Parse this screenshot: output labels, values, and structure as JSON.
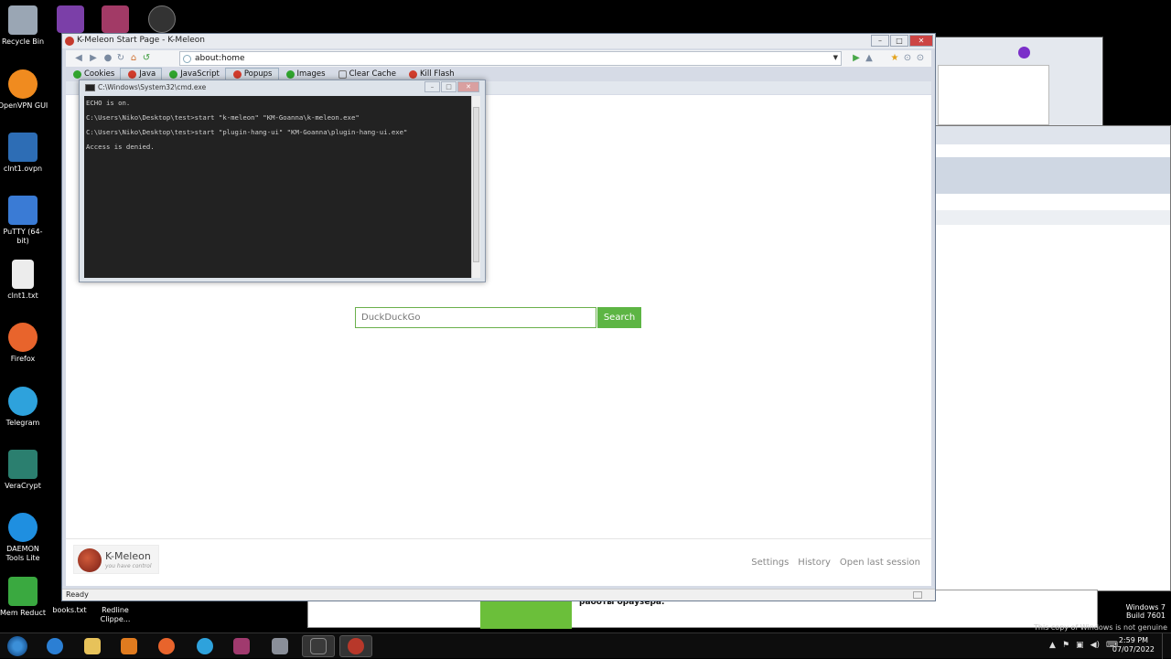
{
  "desktop": {
    "icons": [
      {
        "label": "Recycle Bin",
        "color": "#9aa6b4"
      },
      {
        "label": "OpenVPN GUI",
        "color": "#f08b1f"
      },
      {
        "label": "clnt1.ovpn",
        "color": "#2d6db5"
      },
      {
        "label": "PuTTY (64-bit)",
        "color": "#3a7bd5"
      },
      {
        "label": "clnt1.txt",
        "color": "#ececec"
      },
      {
        "label": "Firefox",
        "color": "#e8642c"
      },
      {
        "label": "Telegram",
        "color": "#2ea2dc"
      },
      {
        "label": "VeraCrypt",
        "color": "#2b7f6f"
      },
      {
        "label": "DAEMON Tools Lite",
        "color": "#1f8fe0"
      },
      {
        "label": "Mem Reduct",
        "color": "#3aa940"
      }
    ],
    "second_column": [
      {
        "label": "books.txt"
      },
      {
        "label": "Redline Clippe..."
      }
    ]
  },
  "browser": {
    "window_title": "K-Meleon Start Page - K-Meleon",
    "address": "about:home",
    "plugins": [
      {
        "label": "Cookies",
        "state": "green",
        "active": false
      },
      {
        "label": "Java",
        "state": "red",
        "active": true
      },
      {
        "label": "JavaScript",
        "state": "green",
        "active": false
      },
      {
        "label": "Popups",
        "state": "red",
        "active": true
      },
      {
        "label": "Images",
        "state": "green",
        "active": false
      },
      {
        "label": "Clear Cache",
        "state": "none",
        "active": false
      },
      {
        "label": "Kill Flash",
        "state": "red",
        "active": false
      }
    ],
    "search": {
      "placeholder": "DuckDuckGo",
      "button": "Search"
    },
    "logo": {
      "name": "K-Meleon",
      "tagline": "you have control"
    },
    "footer_links": [
      "Settings",
      "History",
      "Open last session"
    ],
    "status": "Ready"
  },
  "cmd": {
    "title": "C:\\Windows\\System32\\cmd.exe",
    "lines": [
      "ECHO is on.",
      "C:\\Users\\Niko\\Desktop\\test>start \"k-meleon\" \"KM-Goanna\\k-meleon.exe\"",
      "C:\\Users\\Niko\\Desktop\\test>start \"plugin-hang-ui\" \"KM-Goanna\\plugin-hang-ui.exe\"",
      "Access is denied."
    ]
  },
  "background": {
    "notice_text": "работы браузера.",
    "watermark": {
      "line1": "Windows 7",
      "line2": "Build 7601",
      "genuine": "This copy of Windows is not genuine"
    }
  },
  "taskbar": {
    "apps": [
      {
        "name": "ie",
        "color": "#2b7fd4"
      },
      {
        "name": "explorer",
        "color": "#e7c25a"
      },
      {
        "name": "media",
        "color": "#e07b1f"
      },
      {
        "name": "firefox",
        "color": "#e8642c"
      },
      {
        "name": "telegram",
        "color": "#2ea2dc"
      },
      {
        "name": "winrar",
        "color": "#a03a6e"
      },
      {
        "name": "tools",
        "color": "#8a8f99"
      },
      {
        "name": "cmd",
        "color": "#3a3a3a"
      },
      {
        "name": "k-meleon",
        "color": "#b8382a"
      }
    ],
    "time": "2:59 PM",
    "date": "07/07/2022"
  }
}
